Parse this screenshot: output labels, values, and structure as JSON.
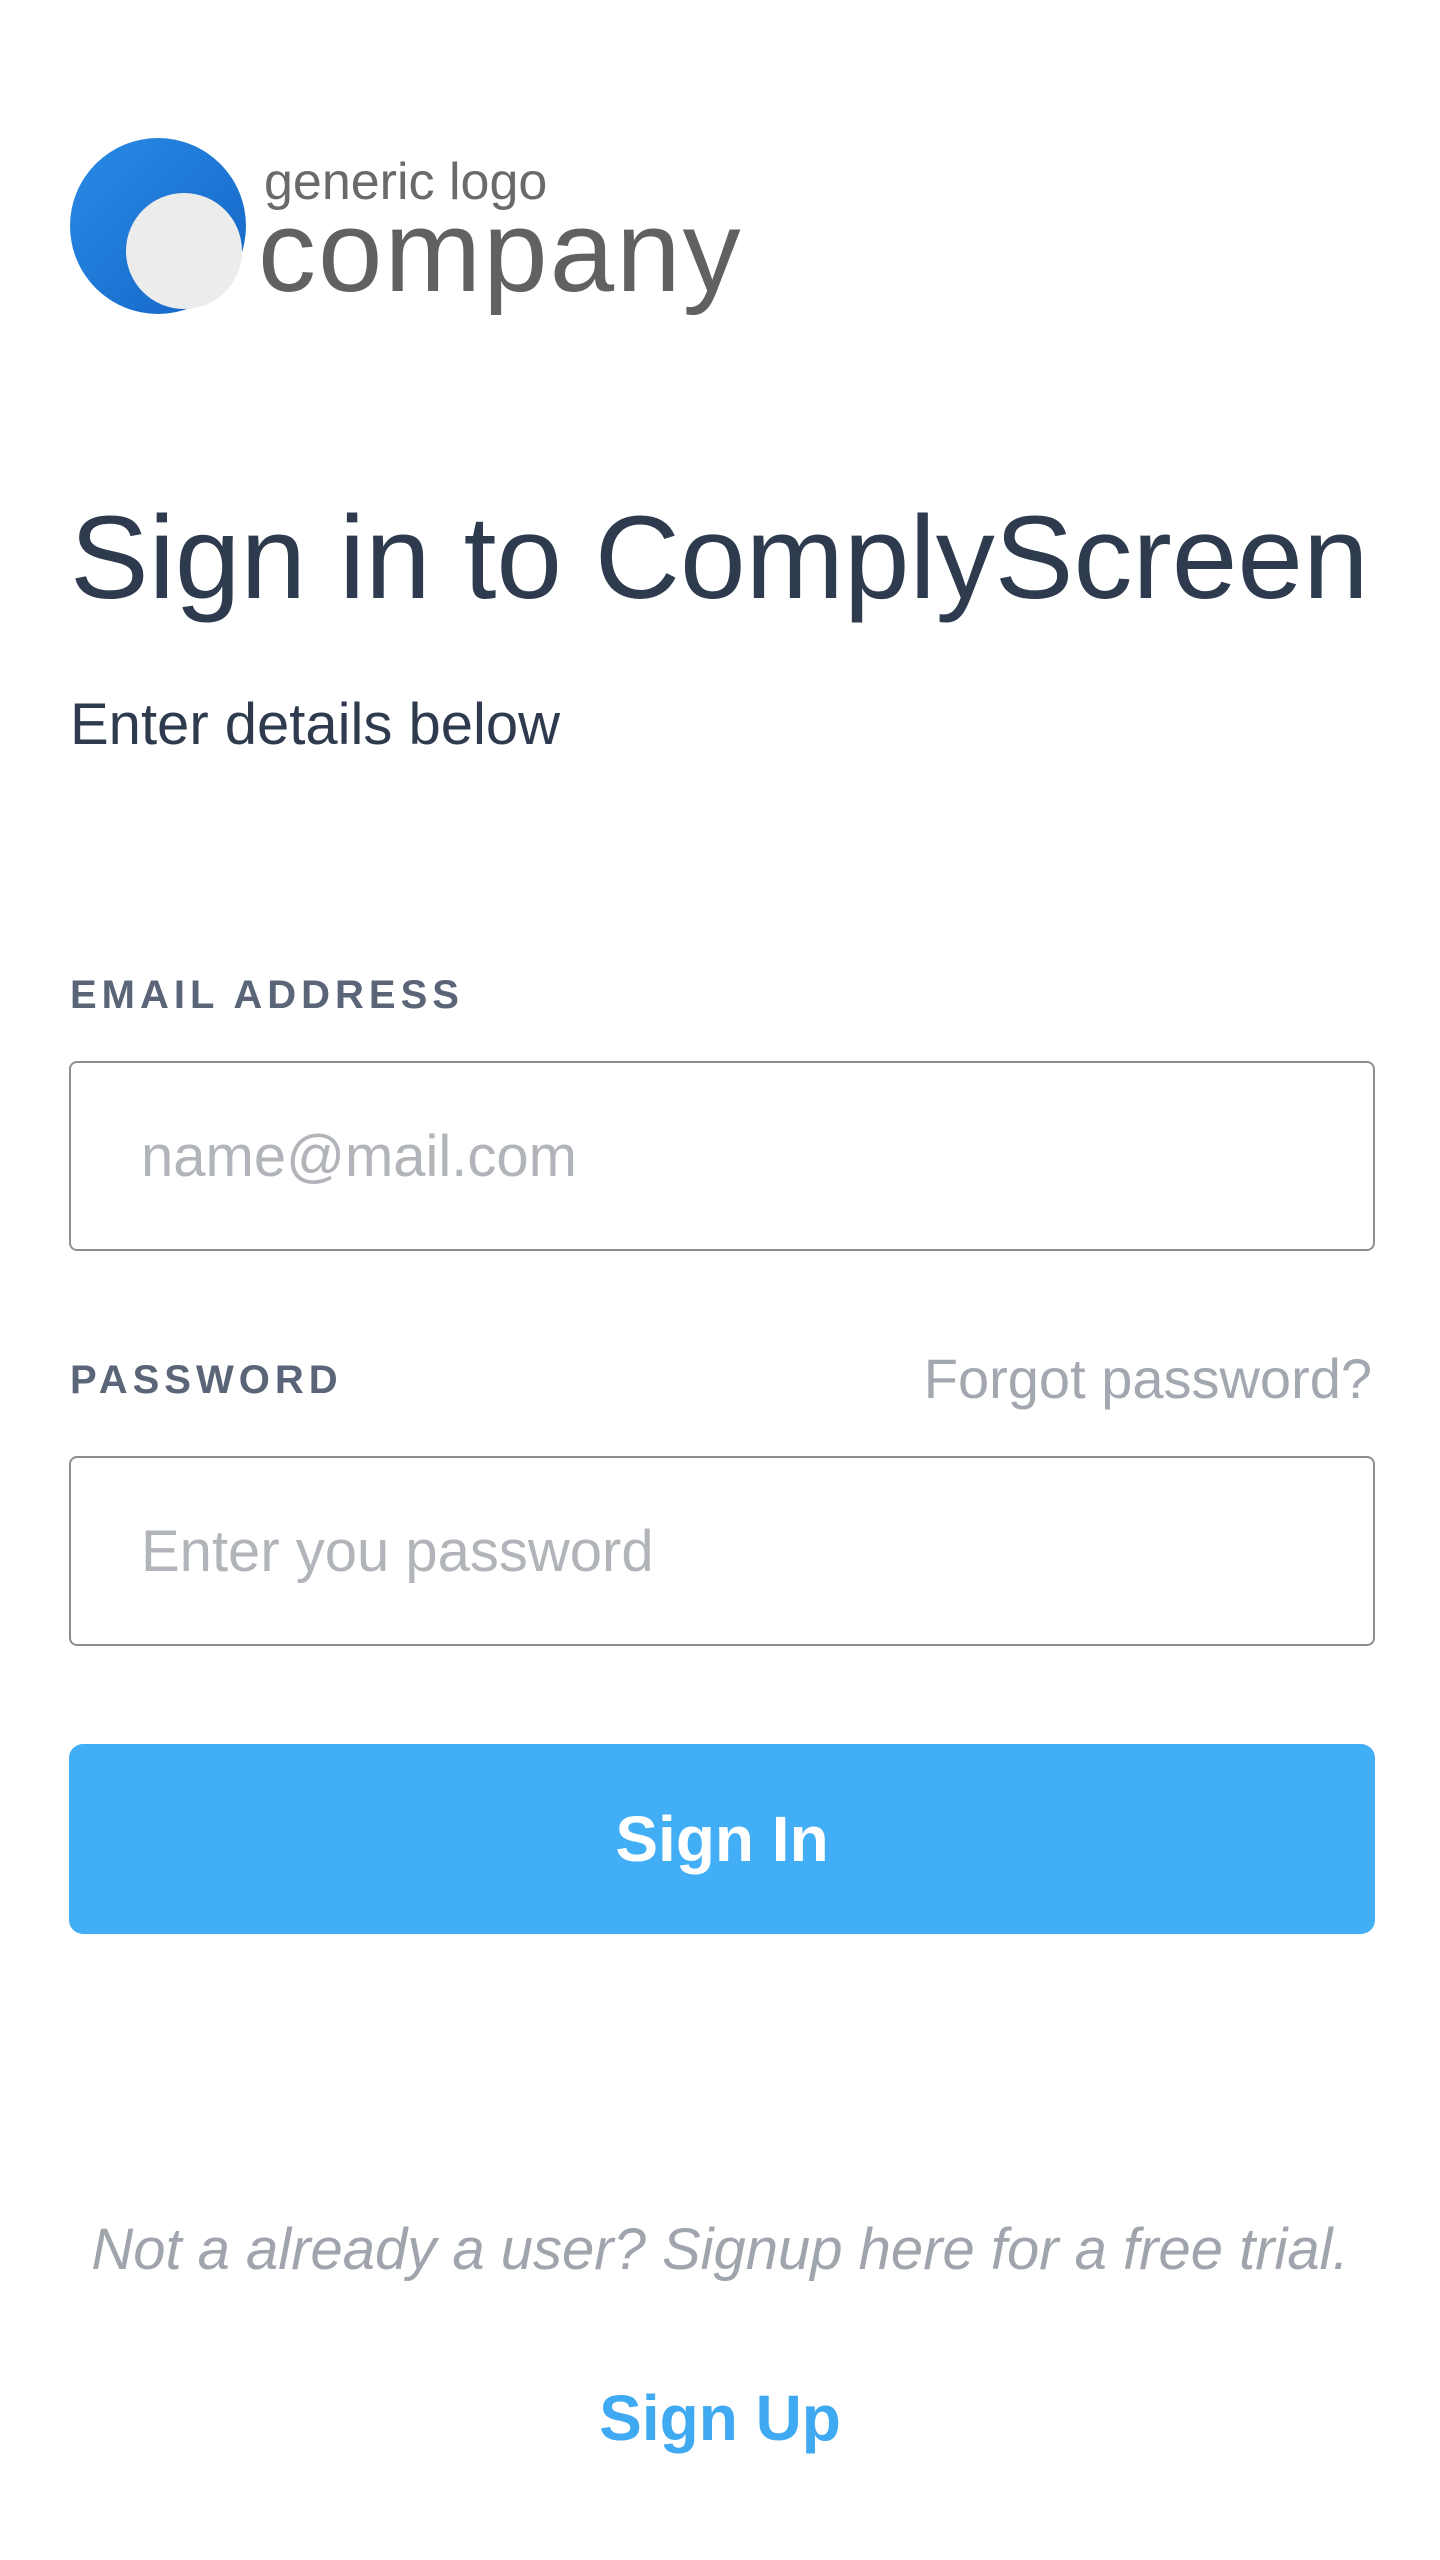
{
  "logo": {
    "small_text": "generic logo",
    "big_text": "company",
    "colors": {
      "circle_outer": "#1f7fd6",
      "circle_inner": "#ececec"
    }
  },
  "header": {
    "title": "Sign in to ComplyScreen",
    "subtitle": "Enter details below"
  },
  "form": {
    "email_label": "EMAIL ADDRESS",
    "email_placeholder": "name@mail.com",
    "email_value": "",
    "password_label": "PASSWORD",
    "forgot_label": "Forgot password?",
    "password_placeholder": "Enter you password",
    "password_value": "",
    "submit_label": "Sign In"
  },
  "footer": {
    "trial_text": "Not a already a user? Signup here for a free trial.",
    "signup_label": "Sign Up"
  },
  "colors": {
    "accent": "#42aef6",
    "heading": "#2e3a4e",
    "muted": "#a0a5ad"
  }
}
